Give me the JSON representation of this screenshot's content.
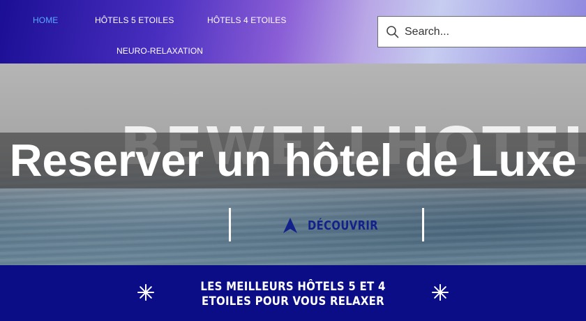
{
  "nav": {
    "items": [
      {
        "label": "HOME",
        "active": true
      },
      {
        "label": "HÔTELS 5 ETOILES",
        "active": false
      },
      {
        "label": "HÔTELS 4 ETOILES",
        "active": false
      },
      {
        "label": "NEURO-RELAXATION",
        "active": false
      }
    ],
    "active_color": "#5aa9ff"
  },
  "search": {
    "placeholder": "Search...",
    "icon": "search-icon"
  },
  "hero": {
    "background_logo_text": "BEWELLHOTELS",
    "title": "Reserver un hôtel de Luxe",
    "cta": {
      "label": "DÉCOUVRIR",
      "icon": "navigation-arrow-icon"
    }
  },
  "banner": {
    "text": "LES MEILLEURS HÔTELS 5 ET 4 ETOILES POUR VOUS RELAXER",
    "icon": "sparkle-icon"
  },
  "colors": {
    "header_start": "#1b0f95",
    "banner": "#0a0d85",
    "cta_text": "#13228a"
  }
}
